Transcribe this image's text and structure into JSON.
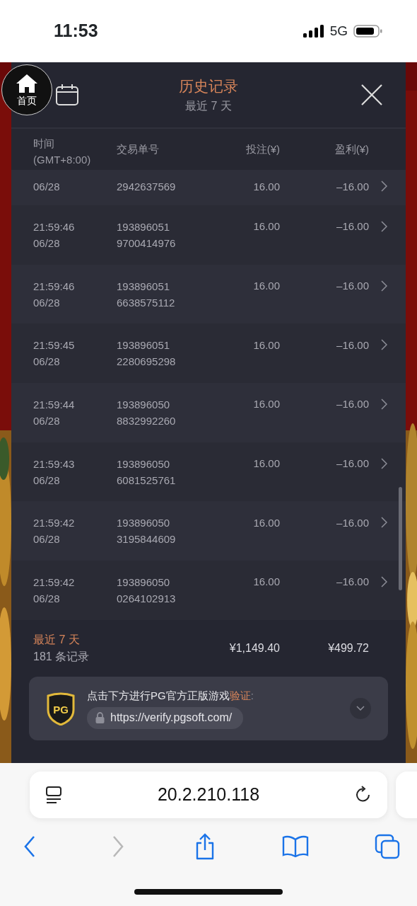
{
  "status_bar": {
    "time": "11:53",
    "network": "5G"
  },
  "home_button": {
    "label": "首页"
  },
  "header": {
    "title": "历史记录",
    "subtitle": "最近 7 天"
  },
  "table": {
    "columns": [
      {
        "label": "时间",
        "sub": "(GMT+8:00)"
      },
      {
        "label": "交易单号"
      },
      {
        "label": "投注(¥)"
      },
      {
        "label": "盈利(¥)"
      }
    ],
    "rows": [
      {
        "date": "06/28",
        "id_tail": "2942637569",
        "bet": "16.00",
        "profit": "–16.00"
      },
      {
        "time": "21:59:46",
        "date": "06/28",
        "id_head": "193896051",
        "id_tail": "9700414976",
        "bet": "16.00",
        "profit": "–16.00"
      },
      {
        "time": "21:59:46",
        "date": "06/28",
        "id_head": "193896051",
        "id_tail": "6638575112",
        "bet": "16.00",
        "profit": "–16.00"
      },
      {
        "time": "21:59:45",
        "date": "06/28",
        "id_head": "193896051",
        "id_tail": "2280695298",
        "bet": "16.00",
        "profit": "–16.00"
      },
      {
        "time": "21:59:44",
        "date": "06/28",
        "id_head": "193896050",
        "id_tail": "8832992260",
        "bet": "16.00",
        "profit": "–16.00"
      },
      {
        "time": "21:59:43",
        "date": "06/28",
        "id_head": "193896050",
        "id_tail": "6081525761",
        "bet": "16.00",
        "profit": "–16.00"
      },
      {
        "time": "21:59:42",
        "date": "06/28",
        "id_head": "193896050",
        "id_tail": "3195844609",
        "bet": "16.00",
        "profit": "–16.00"
      },
      {
        "time": "21:59:42",
        "date": "06/28",
        "id_head": "193896050",
        "id_tail": "0264102913",
        "bet": "16.00",
        "profit": "–16.00"
      }
    ]
  },
  "summary": {
    "period": "最近 7 天",
    "count": "181 条记录",
    "total_bet": "¥1,149.40",
    "total_profit": "¥499.72"
  },
  "verify": {
    "badge": "PG",
    "text": "点击下方进行PG官方正版游戏",
    "highlight": "验证",
    "colon": ":",
    "url": "https://verify.pgsoft.com/"
  },
  "browser": {
    "address": "20.2.210.118",
    "forward_disabled": true
  }
}
